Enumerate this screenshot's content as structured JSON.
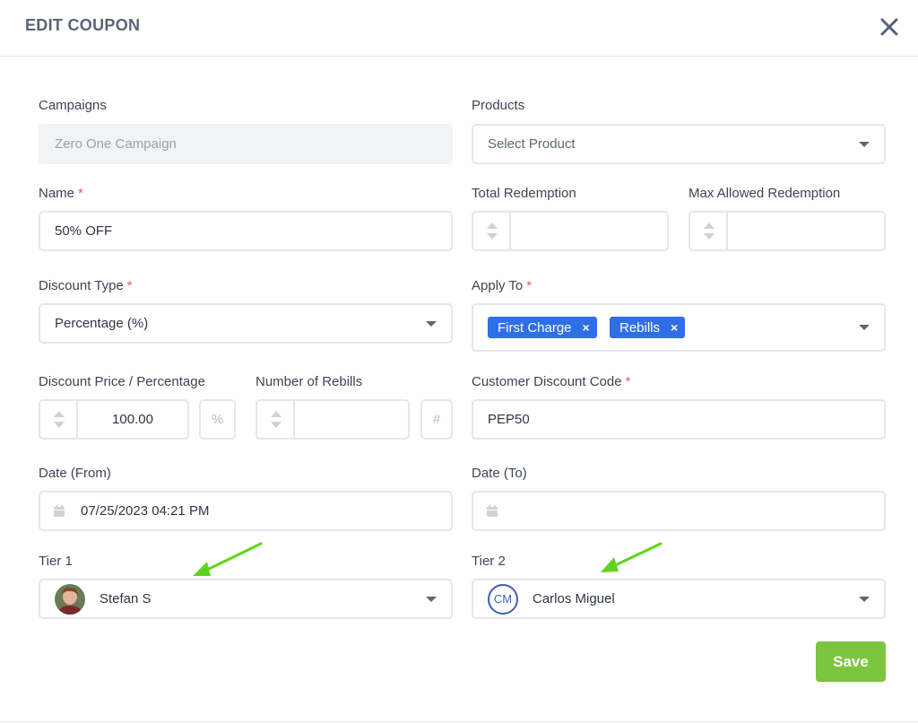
{
  "dialog": {
    "title": "EDIT COUPON"
  },
  "fields": {
    "campaigns": {
      "label": "Campaigns",
      "value": "Zero One Campaign"
    },
    "products": {
      "label": "Products",
      "placeholder": "Select Product"
    },
    "name": {
      "label": "Name",
      "required_mark": "*",
      "value": "50% OFF"
    },
    "total_redemption": {
      "label": "Total Redemption",
      "value": ""
    },
    "max_allowed_redemption": {
      "label": "Max Allowed Redemption",
      "value": ""
    },
    "discount_type": {
      "label": "Discount Type",
      "required_mark": "*",
      "value": "Percentage (%)"
    },
    "apply_to": {
      "label": "Apply To",
      "required_mark": "*",
      "tags": [
        "First Charge",
        "Rebills"
      ],
      "remove_glyph": "×"
    },
    "discount_price": {
      "label": "Discount Price / Percentage",
      "value": "100.00",
      "suffix": "%"
    },
    "number_of_rebills": {
      "label": "Number of Rebills",
      "value": "",
      "suffix": "#"
    },
    "customer_discount_code": {
      "label": "Customer Discount Code",
      "required_mark": "*",
      "value": "PEP50"
    },
    "date_from": {
      "label": "Date (From)",
      "value": "07/25/2023 04:21 PM"
    },
    "date_to": {
      "label": "Date (To)",
      "value": ""
    },
    "tier1": {
      "label": "Tier 1",
      "value": "Stefan S",
      "avatar": "photo"
    },
    "tier2": {
      "label": "Tier 2",
      "value": "Carlos Miguel",
      "initials": "CM"
    }
  },
  "buttons": {
    "save": "Save"
  },
  "colors": {
    "accent_blue": "#2f6fe5",
    "save_green": "#7cc53f",
    "arrow_green": "#5fd41f",
    "required_red": "#e25c5c"
  }
}
